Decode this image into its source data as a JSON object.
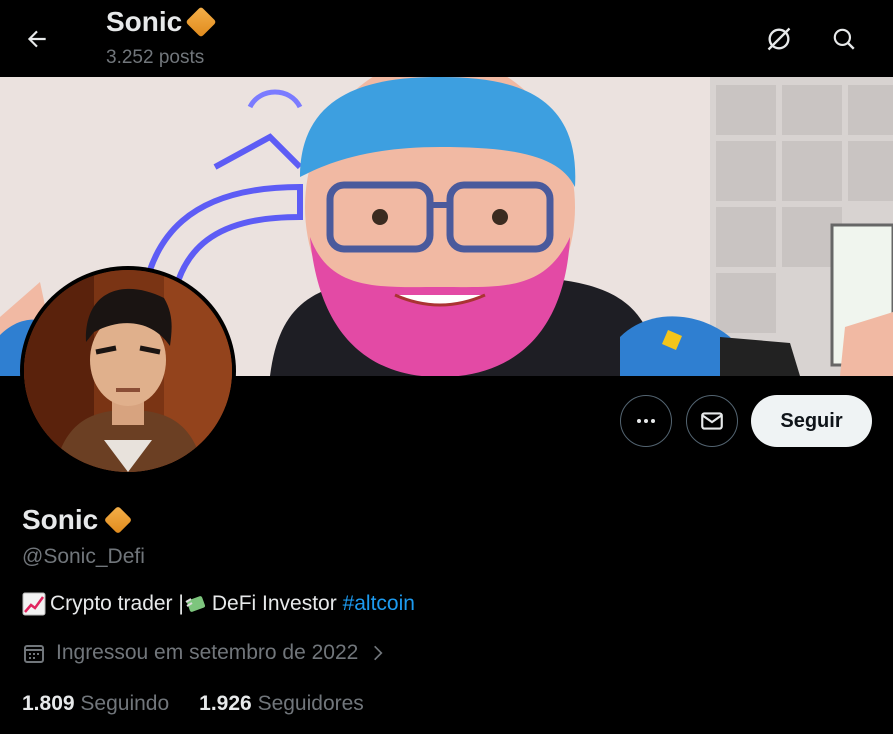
{
  "header": {
    "title": "Sonic",
    "posts_count": "3.252 posts",
    "icons": [
      "arrow-left-icon",
      "verified-diamond-icon",
      "grok-icon",
      "search-icon"
    ]
  },
  "profile": {
    "display_name": "Sonic",
    "handle": "@Sonic_Defi",
    "bio": {
      "part1": "Crypto trader |",
      "part2": "DeFi Investor",
      "hashtag": "#altcoin"
    },
    "joined": "Ingressou em setembro de 2022",
    "following_count": "1.809",
    "following_label": "Seguindo",
    "followers_count": "1.926",
    "followers_label": "Seguidores"
  },
  "actions": {
    "follow_label": "Seguir",
    "more_icon": "ellipsis-icon",
    "message_icon": "mail-icon"
  },
  "colors": {
    "background": "#000000",
    "text": "#e7e9ea",
    "secondary": "#71767b",
    "link": "#1d9bf0",
    "badge": "#e8951e",
    "follow_button": "#eff3f4"
  }
}
